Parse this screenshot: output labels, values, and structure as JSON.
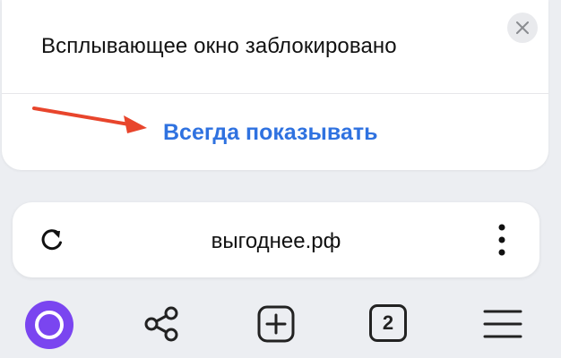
{
  "popup": {
    "message": "Всплывающее окно заблокировано",
    "action_label": "Всегда показывать",
    "close_icon": "close-icon"
  },
  "address_bar": {
    "url": "выгоднее.рф",
    "reload_icon": "reload-icon",
    "menu_icon": "more-vertical-icon"
  },
  "toolbar": {
    "items": [
      {
        "icon": "alice-assistant-icon"
      },
      {
        "icon": "share-icon"
      },
      {
        "icon": "new-tab-plus-icon"
      },
      {
        "icon": "tabs-count-icon",
        "count": "2"
      },
      {
        "icon": "hamburger-menu-icon"
      }
    ]
  },
  "colors": {
    "accent": "#2f72e0",
    "annotation_arrow": "#e8452c",
    "alice": "#7a45f0"
  }
}
